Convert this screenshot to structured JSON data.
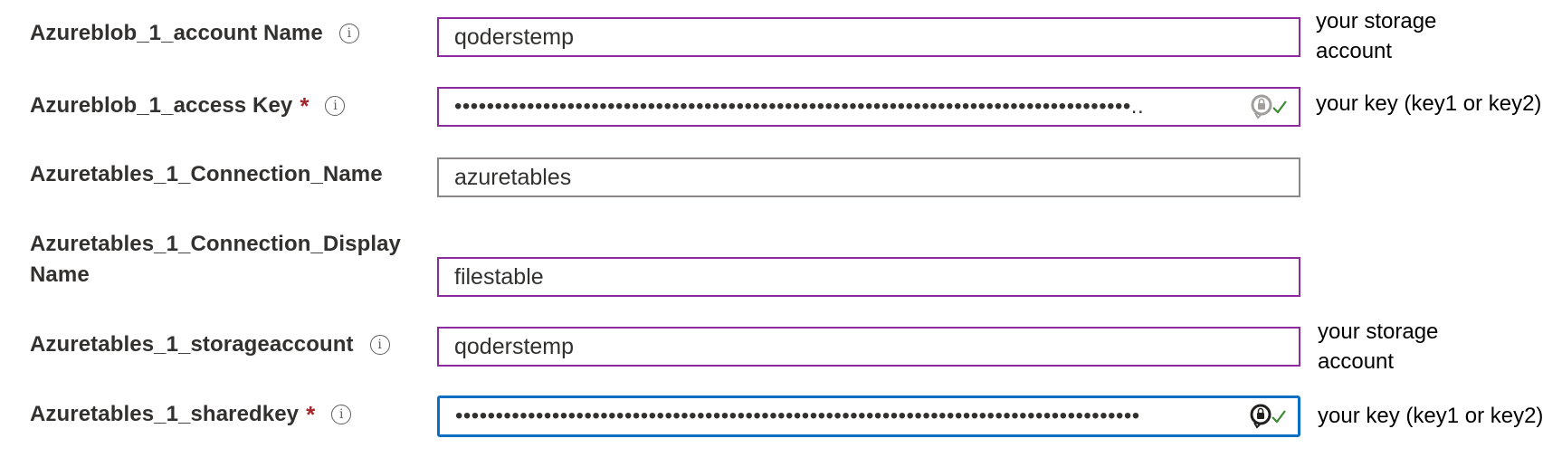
{
  "fields": [
    {
      "label": "Azureblob_1_account Name",
      "required": false,
      "has_info": true,
      "value": "qoderstemp",
      "note": "your storage account"
    },
    {
      "label": "Azureblob_1_access Key",
      "required": true,
      "has_info": true,
      "value": "••••••••••••••••••••••••••••••••••••••••••••••••••••••••••••••••••••••••••••••••••••..",
      "type": "password",
      "note": "your key (key1 or key2)"
    },
    {
      "label": "Azuretables_1_Connection_Name",
      "required": false,
      "has_info": false,
      "value": "azuretables",
      "note": ""
    },
    {
      "label_line1": "Azuretables_1_Connection_Display",
      "label_line2": "Name",
      "required": false,
      "has_info": false,
      "value": "filestable",
      "note": ""
    },
    {
      "label": "Azuretables_1_storageaccount",
      "required": false,
      "has_info": true,
      "value": "qoderstemp",
      "note": "your storage account"
    },
    {
      "label": "Azuretables_1_sharedkey",
      "required": true,
      "has_info": true,
      "value": "•••••••••••••••••••••••••••••••••••••••••••••••••••••••••••••••••••••••••••••••••••••",
      "type": "password",
      "note": "your key (key1 or key2)"
    }
  ],
  "required_marker": "*",
  "info_glyph": "i",
  "note_lines": {
    "storage_line1": "your storage",
    "storage_line2": "account"
  },
  "colors": {
    "input_border_accent": "#8a2c9e",
    "input_border_plain": "#8a8886",
    "input_border_focused": "#0a6fc2",
    "required": "#a4262c",
    "check": "#3a8a2f"
  },
  "icons": {
    "password_manager": "password-manager-icon",
    "check": "check-icon",
    "info": "info-icon"
  }
}
